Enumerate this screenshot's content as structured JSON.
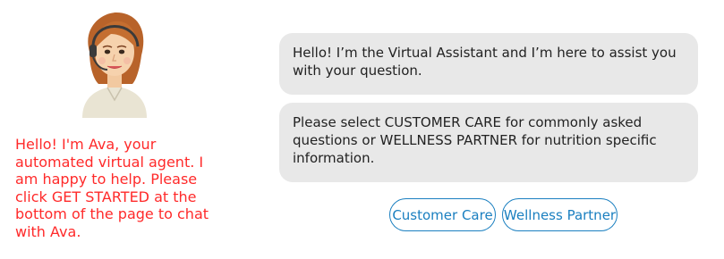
{
  "avatar": {
    "icon": "virtual-agent-avatar-icon"
  },
  "intro": {
    "text": "Hello! I'm Ava, your\nautomated virtual agent. I\nam happy to help. Please\nclick GET STARTED at the\nbottom of the page to chat\nwith Ava."
  },
  "messages": [
    {
      "text": "Hello! I’m the Virtual Assistant and I’m here to assist you with your question."
    },
    {
      "text": "Please select CUSTOMER CARE for commonly asked questions or WELLNESS PARTNER for nutrition specific information."
    }
  ],
  "options": [
    {
      "label": "Customer Care"
    },
    {
      "label": "Wellness Partner"
    }
  ],
  "colors": {
    "intro_text": "#ff2a2a",
    "bubble_bg": "#e8e8e8",
    "button_accent": "#1a7fc0"
  }
}
